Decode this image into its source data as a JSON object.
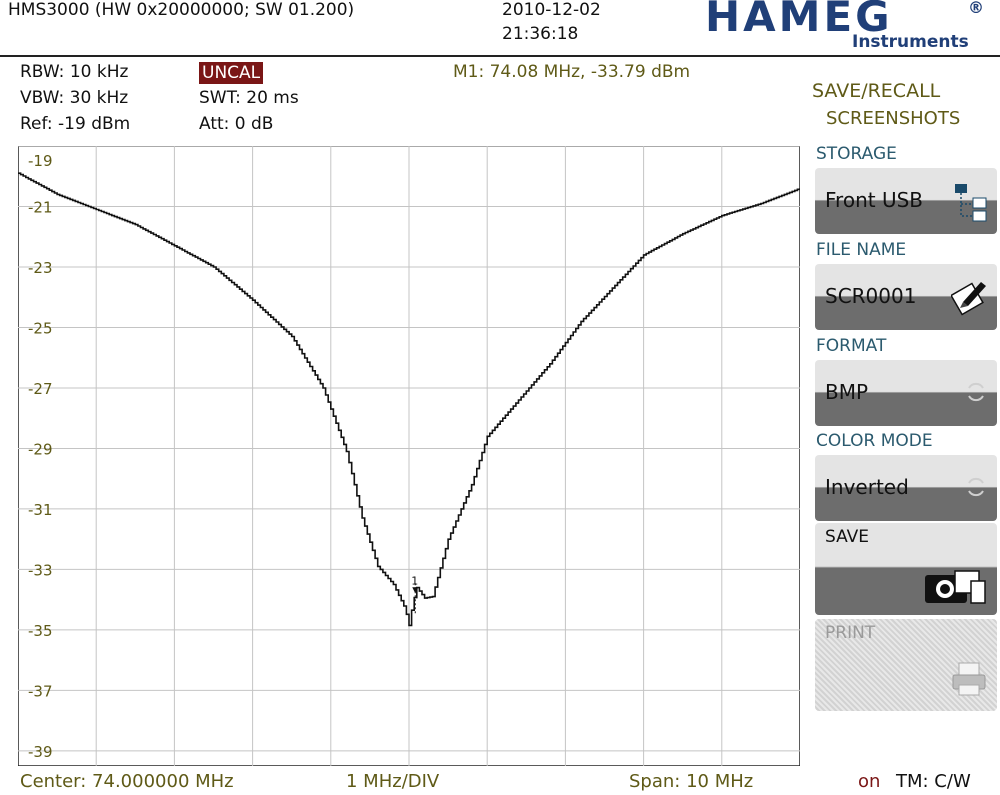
{
  "header": {
    "device": "HMS3000 (HW 0x20000000; SW 01.200)",
    "date": "2010-12-02",
    "time": "21:36:18",
    "logo": "HAMEG",
    "logo_mark": "®",
    "logo_sub": "Instruments"
  },
  "settings": {
    "rbw": "RBW: 10 kHz",
    "vbw": "VBW: 30 kHz",
    "ref": "Ref: -19 dBm",
    "uncal": "UNCAL",
    "swt": "SWT: 20 ms",
    "att": "Att: 0 dB",
    "marker": "M1: 74.08 MHz, -33.79 dBm"
  },
  "menu": {
    "title_line1": "SAVE/RECALL",
    "title_line2": "SCREENSHOTS",
    "storage_label": "STORAGE",
    "storage_value": "Front USB",
    "filename_label": "FILE NAME",
    "filename_value": "SCR0001",
    "format_label": "FORMAT",
    "format_value": "BMP",
    "colormode_label": "COLOR MODE",
    "colormode_value": "Inverted",
    "save_label": "SAVE",
    "print_label": "PRINT"
  },
  "footer": {
    "center": "Center: 74.000000 MHz",
    "div": "1 MHz/DIV",
    "span": "Span: 10 MHz",
    "on": "on",
    "tm": "TM: C/W"
  },
  "colors": {
    "logo": "#203f78",
    "olive_text": "#5f5a17",
    "label_blue": "#2b5a6e",
    "uncal_bg": "#7a1616"
  },
  "chart_data": {
    "type": "line",
    "xlabel": "",
    "ylabel": "",
    "x_unit": "MHz",
    "y_unit": "dBm",
    "xlim": [
      69,
      79
    ],
    "ylim": [
      -39.5,
      -19
    ],
    "y_ticks": [
      -19,
      -21,
      -23,
      -25,
      -27,
      -29,
      -31,
      -33,
      -35,
      -37,
      -39
    ],
    "grid": true,
    "series": [
      {
        "x": [
          69.0,
          69.5,
          70.0,
          70.5,
          71.0,
          71.5,
          72.0,
          72.5,
          72.9,
          73.2,
          73.4,
          73.6,
          73.8,
          73.95,
          74.0,
          74.05,
          74.1,
          74.2,
          74.3,
          74.5,
          74.8,
          75.0,
          75.4,
          75.8,
          76.2,
          76.6,
          77.0,
          77.5,
          78.0,
          78.5,
          79.0
        ],
        "y": [
          -19.9,
          -20.6,
          -21.1,
          -21.6,
          -22.3,
          -23.0,
          -24.1,
          -25.3,
          -27.0,
          -29.1,
          -31.3,
          -32.9,
          -33.5,
          -34.3,
          -34.85,
          -34.1,
          -33.6,
          -33.95,
          -33.9,
          -32.0,
          -30.2,
          -28.6,
          -27.4,
          -26.2,
          -24.8,
          -23.7,
          -22.6,
          -21.9,
          -21.3,
          -20.9,
          -20.4
        ]
      }
    ],
    "marker": {
      "label": "1",
      "x": 74.08,
      "y": -33.79
    }
  }
}
